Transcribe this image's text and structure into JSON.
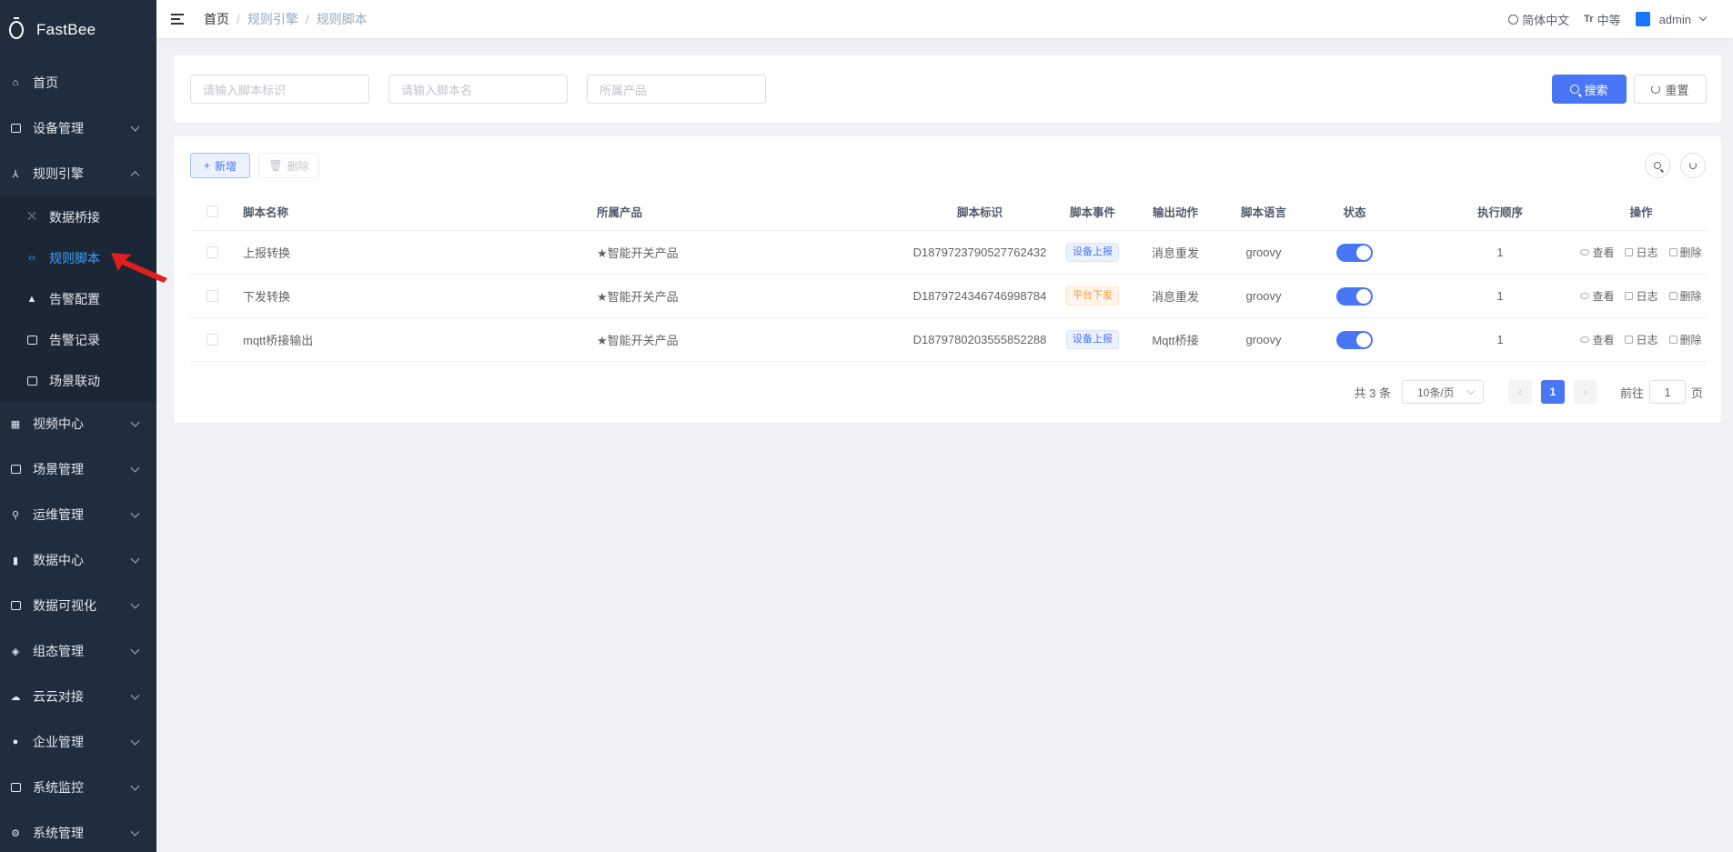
{
  "app": {
    "title": "FastBee"
  },
  "sidebar": {
    "items": [
      {
        "label": "首页",
        "icon": "home-icon"
      },
      {
        "label": "设备管理",
        "icon": "device-icon"
      },
      {
        "label": "规则引擎",
        "icon": "rule-icon",
        "expanded": true,
        "children": [
          {
            "label": "数据桥接",
            "icon": "bridge-icon"
          },
          {
            "label": "规则脚本",
            "icon": "code-icon",
            "active": true
          },
          {
            "label": "告警配置",
            "icon": "alarm-icon"
          },
          {
            "label": "告警记录",
            "icon": "record-icon"
          },
          {
            "label": "场景联动",
            "icon": "scene-icon"
          }
        ]
      },
      {
        "label": "视频中心",
        "icon": "video-icon"
      },
      {
        "label": "场景管理",
        "icon": "scene-manage-icon"
      },
      {
        "label": "运维管理",
        "icon": "ops-icon"
      },
      {
        "label": "数据中心",
        "icon": "chart-icon"
      },
      {
        "label": "数据可视化",
        "icon": "visual-icon"
      },
      {
        "label": "组态管理",
        "icon": "layers-icon"
      },
      {
        "label": "云云对接",
        "icon": "cloud-icon"
      },
      {
        "label": "企业管理",
        "icon": "enterprise-icon"
      },
      {
        "label": "系统监控",
        "icon": "monitor-icon"
      },
      {
        "label": "系统管理",
        "icon": "settings-icon"
      }
    ]
  },
  "header": {
    "breadcrumb": [
      "首页",
      "规则引擎",
      "规则脚本"
    ],
    "language": "简体中文",
    "font_size": "中等",
    "font_icon": "Tr",
    "user": "admin"
  },
  "search": {
    "script_id_placeholder": "请输入脚本标识",
    "script_name_placeholder": "请输入脚本名",
    "product_placeholder": "所属产品",
    "search_label": "搜索",
    "reset_label": "重置"
  },
  "toolbar": {
    "add_label": "新增",
    "delete_label": "删除"
  },
  "table": {
    "headers": {
      "name": "脚本名称",
      "product": "所属产品",
      "script_id": "脚本标识",
      "event": "脚本事件",
      "action": "输出动作",
      "language": "脚本语言",
      "status": "状态",
      "order": "执行顺序",
      "ops": "操作"
    },
    "rows": [
      {
        "name": "上报转换",
        "product": "★智能开关产品",
        "script_id": "D1879723790527762432",
        "event": "设备上报",
        "event_color": "#4876f7",
        "action": "消息重发",
        "language": "groovy",
        "enabled": true,
        "order": "1"
      },
      {
        "name": "下发转换",
        "product": "★智能开关产品",
        "script_id": "D1879724346746998784",
        "event": "平台下发",
        "event_color": "#ff9a2e",
        "action": "消息重发",
        "language": "groovy",
        "enabled": true,
        "order": "1"
      },
      {
        "name": "mqtt桥接输出",
        "product": "★智能开关产品",
        "script_id": "D1879780203555852288",
        "event": "设备上报",
        "event_color": "#4876f7",
        "action": "Mqtt桥接",
        "language": "groovy",
        "enabled": true,
        "order": "1"
      }
    ],
    "ops": {
      "view": "查看",
      "log": "日志",
      "delete": "删除"
    }
  },
  "pagination": {
    "total_text": "共 3 条",
    "page_size": "10条/页",
    "current_page": "1",
    "goto_label": "前往",
    "goto_value": "1",
    "page_suffix": "页"
  },
  "colors": {
    "accent": "#4876f7",
    "sidebar_bg": "#1f2d3d",
    "active_menu": "#409eff",
    "annotation_arrow": "#e02020"
  }
}
